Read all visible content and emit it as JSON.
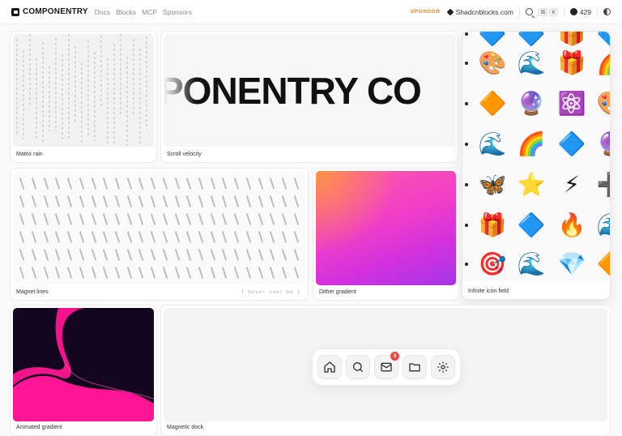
{
  "header": {
    "brand": "COMPONENTRY",
    "nav": [
      "Docs",
      "Blocks",
      "MCP",
      "Sponsors"
    ],
    "sponsor_tag": "SPONSOR",
    "sponsor_site": "Shadcnblocks.com",
    "kbd": [
      "⌘",
      "K"
    ],
    "github_stars": "429"
  },
  "cards": {
    "matrix_rain": "Matrix rain",
    "scroll_velocity": "Scroll velocity",
    "scroll_text": "PONENTRY CO",
    "infinite_icon_field": "Infinite icon field",
    "magnet_lines": "Magnet lines",
    "magnet_hint": "[ hover over me ]",
    "dither_gradient": "Dither gradient",
    "animated_gradient": "Animated gradient",
    "magnetic_dock": "Magnetic dock"
  },
  "dock": {
    "items": [
      "home-icon",
      "search-icon",
      "mail-icon",
      "folder-icon",
      "settings-icon"
    ],
    "mail_badge": "3"
  },
  "colors": {
    "accent_sponsor": "#e0861e",
    "badge": "#ef4444",
    "animated_gradient_pink": "#ff1493",
    "animated_gradient_bg": "#15061f"
  }
}
